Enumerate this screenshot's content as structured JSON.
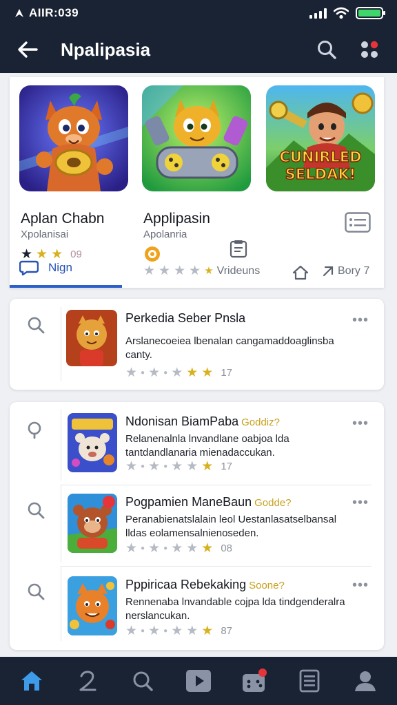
{
  "status": {
    "time": "AIIR:039"
  },
  "app_bar": {
    "title": "Npalipasia"
  },
  "featured": {
    "items": [
      {
        "title": "Aplan Chabn",
        "subtitle": "Xpolanisai",
        "rating": "09"
      },
      {
        "title": "Applipasin",
        "subtitle": "Apolanria"
      },
      {
        "art_text": "CUNIRLED SELDAK!"
      }
    ],
    "tab_active": "Nign",
    "middle_label": "Vrideuns",
    "right_label": "Bory 7"
  },
  "list": [
    {
      "title": "Perkedia Seber Pnsla",
      "badge": "",
      "desc": "Arslanecoeiea lbenalan cangamaddoaglinsba canty.",
      "rating": "17"
    },
    {
      "title": "Ndonisan BiamPaba",
      "badge": "Goddiz?",
      "desc": "Relanenalnla lnvandlane oabjoa lda tantdandlanaria mienadaccukan.",
      "rating": "17"
    },
    {
      "title": "Pogpamien ManeBaun",
      "badge": "Godde?",
      "desc": "Peranabienatslalain leol Uestanlasatselbansal lldas eolamensalnienoseden.",
      "rating": "08"
    },
    {
      "title": "Pppiricaa Rebekaking",
      "badge": "Soone?",
      "desc": "Rennenaba lnvandable cojpa lda tindgenderalra nerslancukan.",
      "rating": "87"
    }
  ],
  "colors": {
    "header_bg": "#1a2333",
    "accent": "#2b60c9",
    "star_gold": "#d8b11f",
    "battery": "#3fd76a",
    "notification": "#e5353b"
  }
}
